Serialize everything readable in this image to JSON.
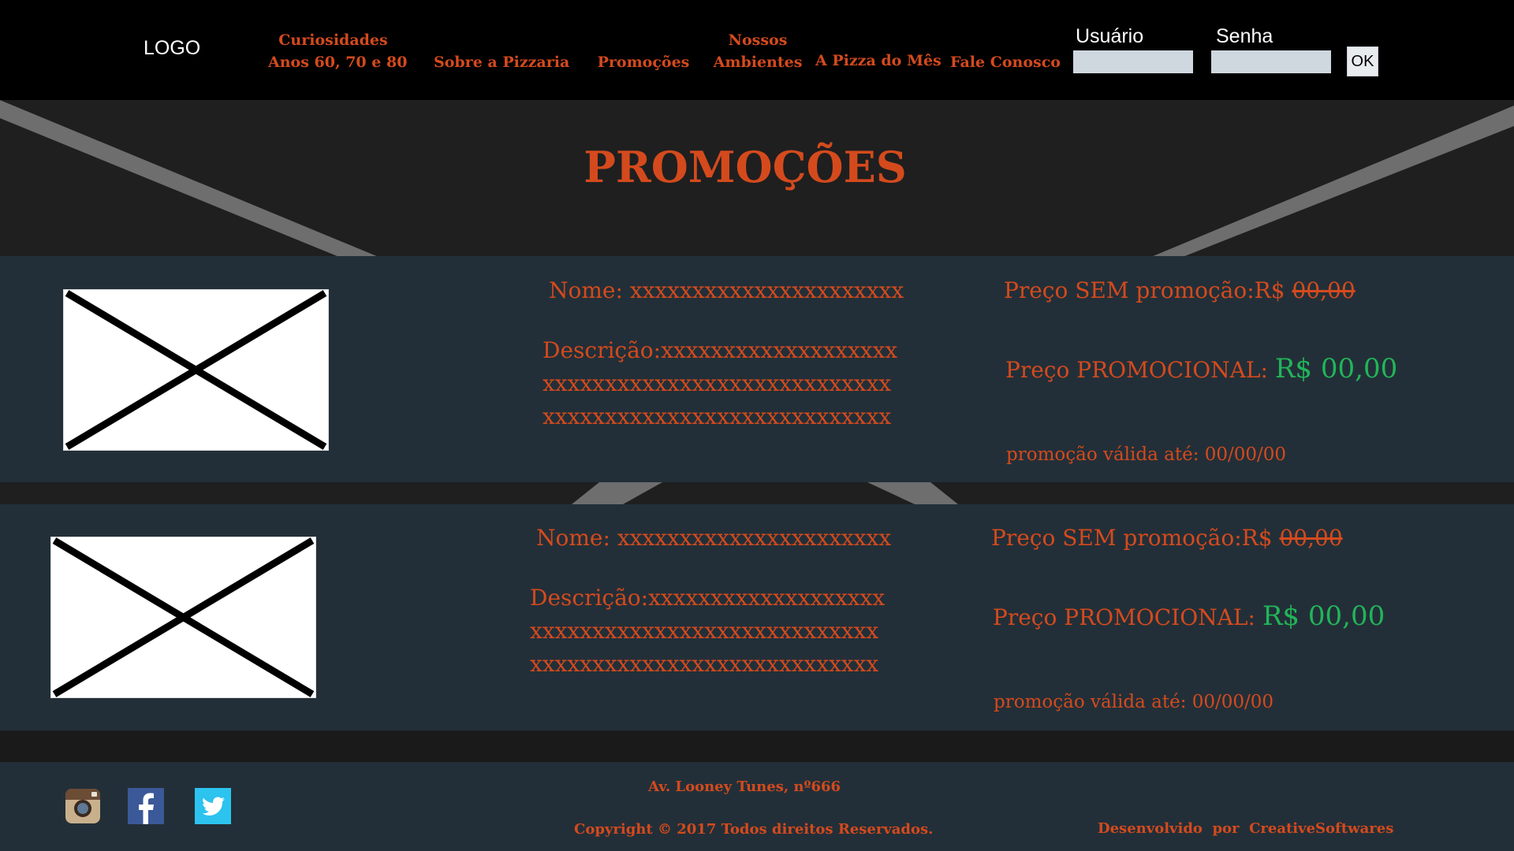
{
  "header": {
    "logo": "LOGO",
    "nav": [
      {
        "line1": "Curiosidades",
        "line2": "Anos 60, 70 e 80"
      },
      {
        "line1": "",
        "line2": "Sobre a Pizzaria"
      },
      {
        "line1": "",
        "line2": "Promoções"
      },
      {
        "line1": "Nossos",
        "line2": "Ambientes"
      },
      {
        "line1": "",
        "line2": "A Pizza do Mês"
      },
      {
        "line1": "",
        "line2": "Fale Conosco"
      }
    ],
    "login": {
      "user_label": "Usuário",
      "user_value": "",
      "password_label": "Senha",
      "password_value": "",
      "ok_label": "OK"
    }
  },
  "page_title": "PROMOÇÕES",
  "promotions": [
    {
      "name": "Nome: xxxxxxxxxxxxxxxxxxxxxx",
      "desc_lines": [
        "Descrição:xxxxxxxxxxxxxxxxxxx",
        "xxxxxxxxxxxxxxxxxxxxxxxxxxxx",
        "xxxxxxxxxxxxxxxxxxxxxxxxxxxx"
      ],
      "price_old_label": "Preço SEM promoção:",
      "price_old_currency": "R$ ",
      "price_old_value": "00,00",
      "price_new_label": "Preço PROMOCIONAL: ",
      "price_new_value": "R$ 00,00",
      "valid_until": "promoção válida até: 00/00/00"
    },
    {
      "name": "Nome: xxxxxxxxxxxxxxxxxxxxxx",
      "desc_lines": [
        "Descrição:xxxxxxxxxxxxxxxxxxx",
        "xxxxxxxxxxxxxxxxxxxxxxxxxxxx",
        "xxxxxxxxxxxxxxxxxxxxxxxxxxxx"
      ],
      "price_old_label": "Preço SEM promoção:",
      "price_old_currency": "R$ ",
      "price_old_value": "00,00",
      "price_new_label": "Preço PROMOCIONAL: ",
      "price_new_value": "R$ 00,00",
      "valid_until": "promoção válida até: 00/00/00"
    }
  ],
  "footer": {
    "address": "Av. Looney Tunes, nº666",
    "copyright": "Copyright © 2017 Todos direitos Reservados.",
    "developer": "Desenvolvido  por  CreativeSoftwares",
    "social": [
      "instagram-icon",
      "facebook-icon",
      "twitter-icon"
    ]
  },
  "colors": {
    "accent": "#d44a1d",
    "promo_price": "#21b559",
    "header_bg": "#000000",
    "card_bg": "#232f38",
    "page_bg": "#1f1f1f"
  }
}
